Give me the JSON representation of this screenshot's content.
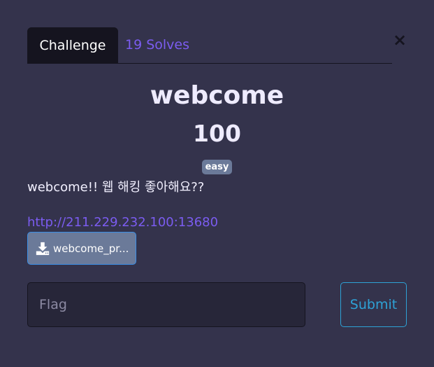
{
  "tabs": {
    "challenge_label": "Challenge",
    "solves_label": "19 Solves"
  },
  "close_symbol": "×",
  "challenge": {
    "name": "webcome",
    "points": "100",
    "difficulty": "easy",
    "description": "webcome!! 웹 해킹 좋아해요??",
    "link": "http://211.229.232.100:13680",
    "file_name": "webcome_pr..."
  },
  "form": {
    "flag_placeholder": "Flag",
    "flag_value": "",
    "submit_label": "Submit"
  },
  "icons": {
    "close": "close-icon",
    "download": "download-icon"
  },
  "colors": {
    "background": "#34334c",
    "tab_active_bg": "#15141f",
    "accent_purple": "#7b5cf0",
    "submit_blue": "#2ea2d6",
    "badge_bg": "#6b7a99"
  }
}
